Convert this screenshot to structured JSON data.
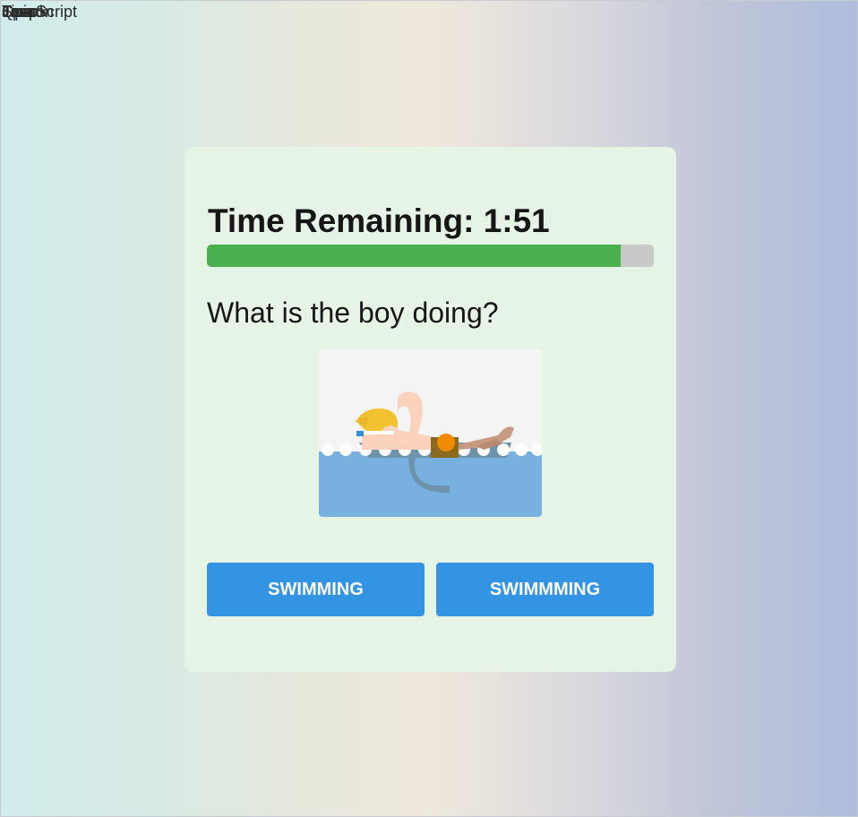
{
  "overlap_texts": [
    "JavaScript",
    "Lesson",
    "Quiz",
    "Tips",
    "Speak",
    "Loop"
  ],
  "quiz": {
    "timer_label": "Time Remaining: 1:51",
    "progress_fraction": 0.926,
    "question": "What is the boy doing?",
    "image_icon": "swimmer-illustration",
    "options": [
      "Swimming",
      "Swimmming"
    ]
  },
  "colors": {
    "progress_fill": "#4caf50",
    "progress_track": "#c9c9c9",
    "button": "#3494e4",
    "card": "#e6f4e6"
  }
}
